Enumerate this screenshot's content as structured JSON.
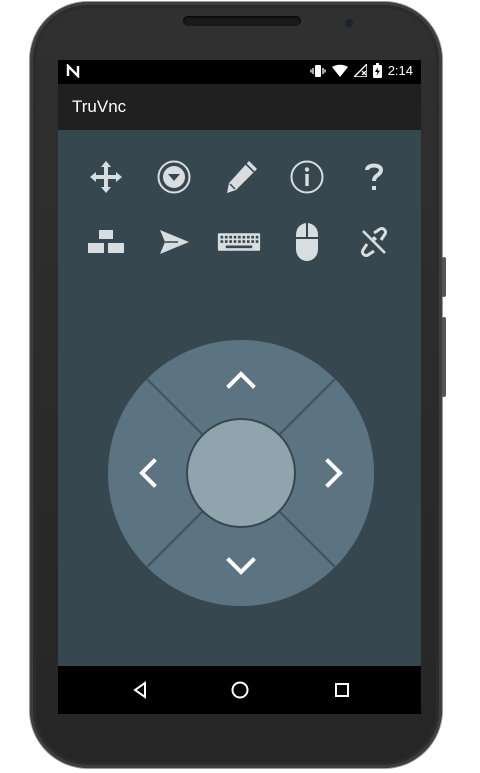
{
  "status_bar": {
    "notification_icon": "n-logo-icon",
    "time": "2:14",
    "icons": [
      "vibrate-icon",
      "wifi-icon",
      "no-signal-icon",
      "battery-charging-icon"
    ]
  },
  "app_bar": {
    "title": "TruVnc"
  },
  "toolbar_row1": [
    "move-icon",
    "dropdown-circle-icon",
    "pencil-icon",
    "info-icon",
    "help-icon"
  ],
  "toolbar_row2": [
    "network-icon",
    "send-icon",
    "keyboard-icon",
    "mouse-icon",
    "disconnect-link-icon"
  ],
  "dpad": {
    "buttons": [
      "up-arrow-icon",
      "left-arrow-icon",
      "right-arrow-icon",
      "down-arrow-icon",
      "center-button"
    ]
  },
  "nav_bar": [
    "back-icon",
    "home-icon",
    "recents-icon"
  ],
  "colors": {
    "screen_bg": "#37474f",
    "app_bar_bg": "#202020",
    "dpad_ring": "#5c7482",
    "dpad_center": "#90a4ae",
    "icon": "#d8dde0"
  }
}
